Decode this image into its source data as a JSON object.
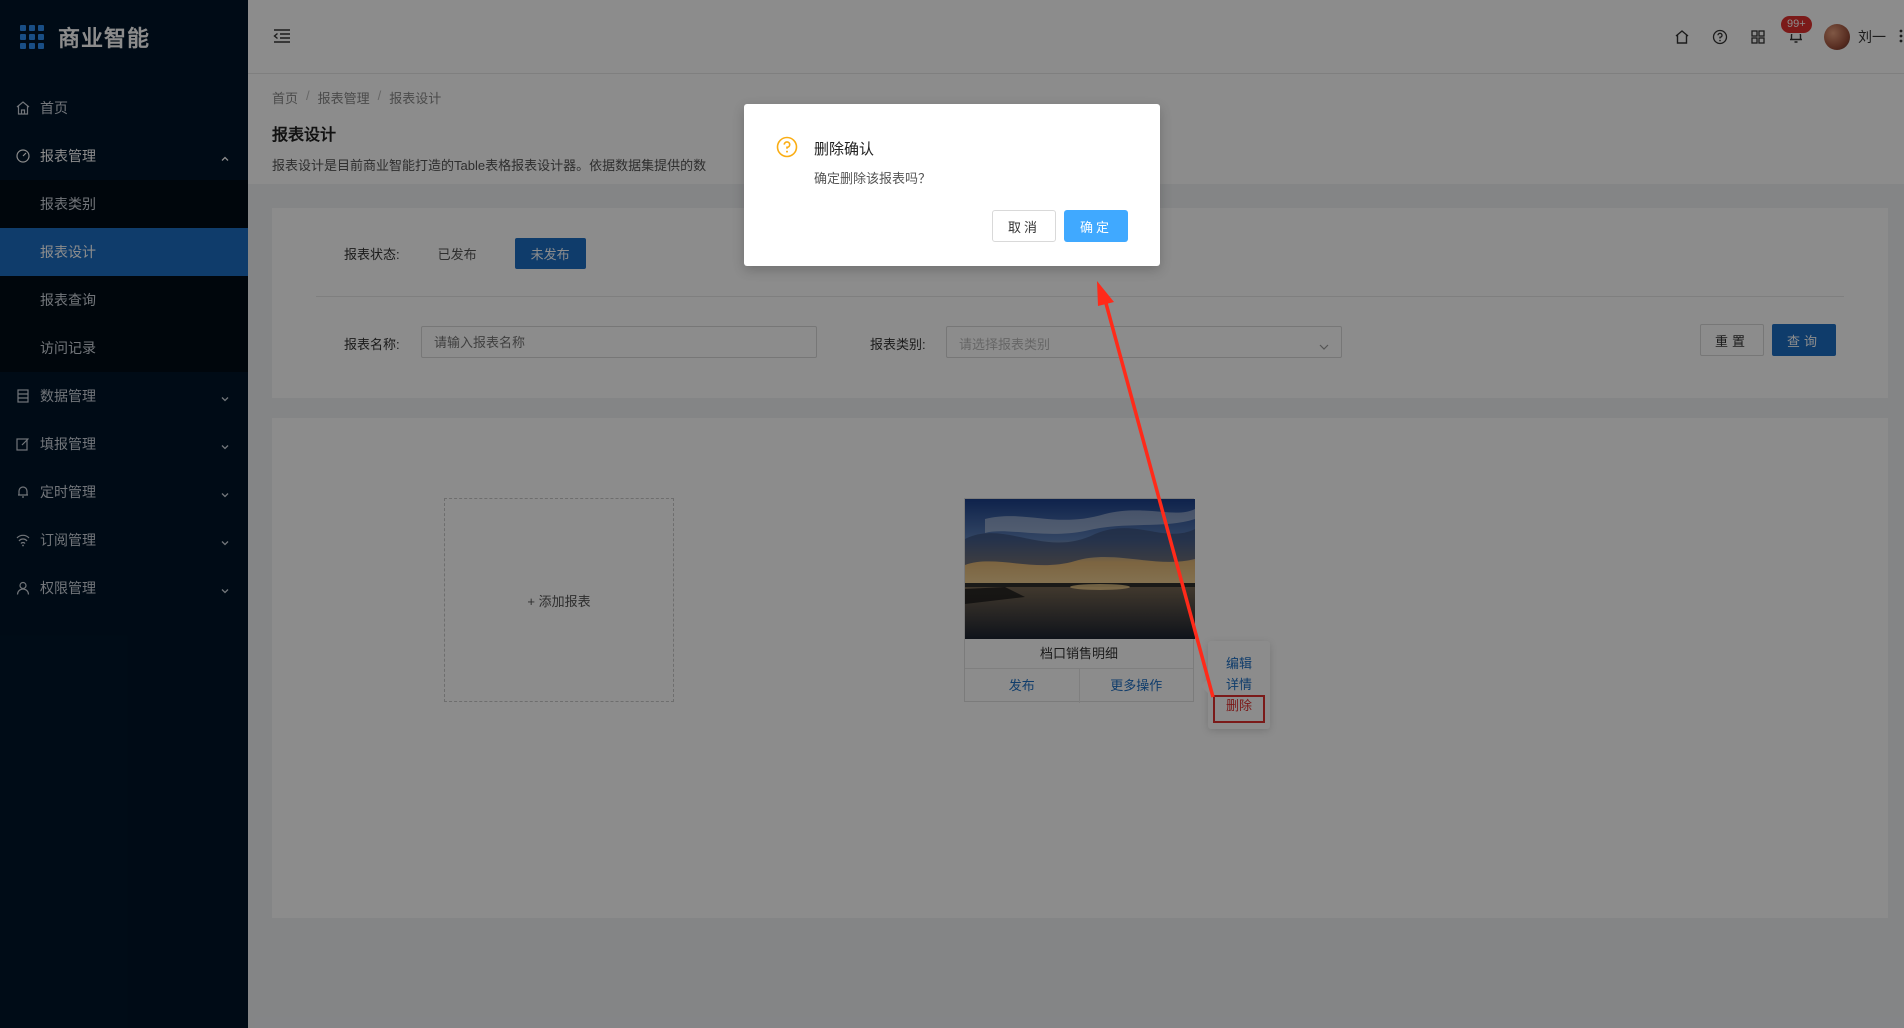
{
  "app": {
    "title": "商业智能"
  },
  "sidebar": {
    "items": [
      {
        "label": "首页",
        "icon": "home-icon"
      },
      {
        "label": "报表管理",
        "icon": "dashboard-icon",
        "expanded": true,
        "children": [
          {
            "label": "报表类别"
          },
          {
            "label": "报表设计",
            "active": true
          },
          {
            "label": "报表查询"
          },
          {
            "label": "访问记录"
          }
        ]
      },
      {
        "label": "数据管理",
        "icon": "database-icon"
      },
      {
        "label": "填报管理",
        "icon": "edit-icon"
      },
      {
        "label": "定时管理",
        "icon": "bell-icon"
      },
      {
        "label": "订阅管理",
        "icon": "wifi-icon"
      },
      {
        "label": "权限管理",
        "icon": "user-icon"
      }
    ]
  },
  "topbar": {
    "notification_badge": "99+",
    "username": "刘一"
  },
  "header": {
    "breadcrumb": [
      "首页",
      "报表管理",
      "报表设计"
    ],
    "title": "报表设计",
    "description": "报表设计是目前商业智能打造的Table表格报表设计器。依据数据集提供的数"
  },
  "filters": {
    "status_label": "报表状态:",
    "status_options": [
      "已发布",
      "未发布"
    ],
    "status_selected": "未发布",
    "name_label": "报表名称:",
    "name_placeholder": "请输入报表名称",
    "category_label": "报表类别:",
    "category_placeholder": "请选择报表类别",
    "reset_label": "重置",
    "query_label": "查询"
  },
  "content": {
    "add_label": "+ 添加报表",
    "report": {
      "name": "档口销售明细",
      "publish_label": "发布",
      "more_label": "更多操作"
    },
    "more_menu": [
      "编辑",
      "详情",
      "删除"
    ]
  },
  "dialog": {
    "title": "删除确认",
    "content": "确定删除该报表吗？",
    "cancel_label": "取消",
    "ok_label": "确定"
  },
  "colors": {
    "sidebar_bg": "#001529",
    "primary": "#1c6ec4",
    "dialog_ok": "#40a9ff",
    "danger": "#e0302e",
    "warning_icon": "#faad14"
  }
}
